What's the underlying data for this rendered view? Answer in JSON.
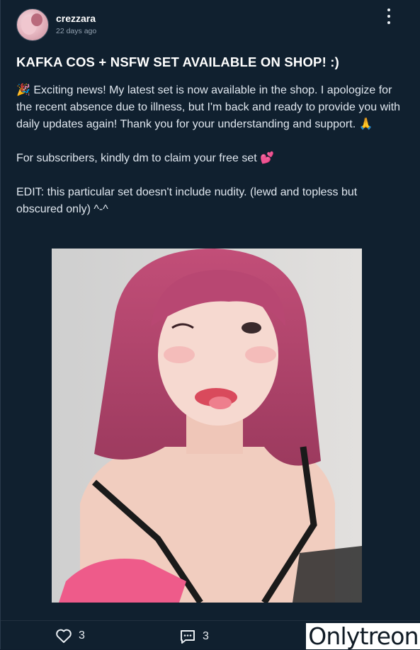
{
  "post": {
    "username": "crezzara",
    "timestamp": "22 days ago",
    "title": "KAFKA COS + NSFW SET AVAILABLE ON SHOP! :)",
    "paragraphs": [
      "🎉 Exciting news! My latest set is now available in the shop. I apologize for the recent absence due to illness, but I'm back and ready to provide you with daily updates again! Thank you for your understanding and support. 🙏",
      "For subscribers, kindly dm to claim your free set 💕",
      "EDIT: this particular set doesn't include nudity. (lewd and topless but obscured only) ^-^"
    ]
  },
  "actions": {
    "likes": "3",
    "comments": "3"
  },
  "watermark": "Onlytreon",
  "icons": {
    "menu": "more-vertical-icon",
    "like": "heart-icon",
    "comment": "comment-icon"
  },
  "colors": {
    "background": "#10202f",
    "text": "#dfe6ee",
    "hair": "#b8486f"
  }
}
